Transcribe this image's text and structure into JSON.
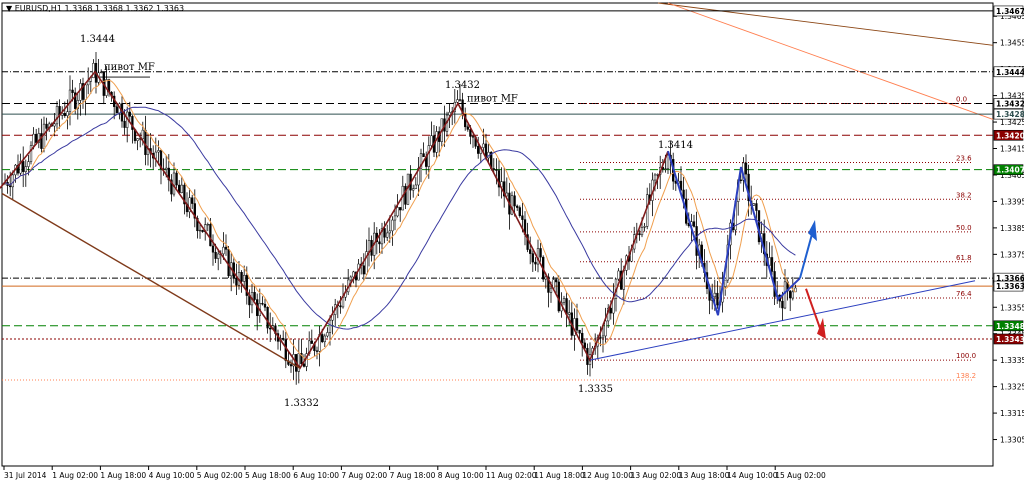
{
  "chart_data": {
    "type": "candlestick",
    "title": "EURUSD,H1  1.3368 1.3368 1.3362 1.3363",
    "ylim": [
      1.3295,
      1.347
    ],
    "x_ticks": [
      "31 Jul 2014",
      "1 Aug 02:00",
      "1 Aug 18:00",
      "4 Aug 10:00",
      "5 Aug 02:00",
      "5 Aug 18:00",
      "6 Aug 10:00",
      "7 Aug 02:00",
      "7 Aug 18:00",
      "8 Aug 10:00",
      "11 Aug 02:00",
      "11 Aug 18:00",
      "12 Aug 10:00",
      "13 Aug 02:00",
      "13 Aug 18:00",
      "14 Aug 10:00",
      "15 Aug 02:00"
    ],
    "y_ticks": [
      1.3305,
      1.3315,
      1.3325,
      1.3335,
      1.3345,
      1.3355,
      1.3365,
      1.3375,
      1.3385,
      1.3395,
      1.3405,
      1.3415,
      1.3425,
      1.3435,
      1.3445,
      1.3455,
      1.3465
    ],
    "price_boxes": [
      {
        "value": "1.3467",
        "price": 1.3467,
        "bg": "#ffffff",
        "fg": "#000000"
      },
      {
        "value": "1.3444",
        "price": 1.3444,
        "bg": "#ffffff",
        "fg": "#000000"
      },
      {
        "value": "1.3432",
        "price": 1.3432,
        "bg": "#ffffff",
        "fg": "#000000"
      },
      {
        "value": "1.3428",
        "price": 1.3428,
        "bg": "#ffffff",
        "fg": "#2f4f4f"
      },
      {
        "value": "1.3420",
        "price": 1.342,
        "bg": "#8b0000",
        "fg": "#ffffff"
      },
      {
        "value": "1.3407",
        "price": 1.3407,
        "bg": "#008000",
        "fg": "#ffffff"
      },
      {
        "value": "1.3366",
        "price": 1.3366,
        "bg": "#ffffff",
        "fg": "#000000"
      },
      {
        "value": "1.3363",
        "price": 1.3363,
        "bg": "#ffffff",
        "fg": "#000000"
      },
      {
        "value": "1.3348",
        "price": 1.3348,
        "bg": "#008000",
        "fg": "#ffffff"
      },
      {
        "value": "1.3343",
        "price": 1.3343,
        "bg": "#8b0000",
        "fg": "#ffffff"
      }
    ],
    "fib_levels": [
      {
        "label": "0.0",
        "price": 1.3432
      },
      {
        "label": "23.6",
        "price": 1.34097
      },
      {
        "label": "38.2",
        "price": 1.33958
      },
      {
        "label": "50.0",
        "price": 1.33835
      },
      {
        "label": "61.8",
        "price": 1.33722
      },
      {
        "label": "76.4",
        "price": 1.33585
      },
      {
        "label": "100.0",
        "price": 1.3335
      },
      {
        "label": "138.2",
        "price": 1.33275
      }
    ],
    "annotations": [
      {
        "text": "1.3444"
      },
      {
        "text": "1.3432"
      },
      {
        "text": "1.3414"
      },
      {
        "text": "1.3332"
      },
      {
        "text": "1.3335"
      },
      {
        "text": "пивот MF"
      },
      {
        "text": "пивот MF"
      }
    ],
    "zigzag": [
      {
        "t": 0,
        "p": 1.34
      },
      {
        "t": 95,
        "p": 1.3444
      },
      {
        "t": 300,
        "p": 1.3332
      },
      {
        "t": 458,
        "p": 1.3432
      },
      {
        "t": 590,
        "p": 1.3335
      },
      {
        "t": 668,
        "p": 1.3414
      }
    ],
    "blue_pattern": [
      {
        "t": 668,
        "p": 1.3414
      },
      {
        "t": 718,
        "p": 1.3352
      },
      {
        "t": 741,
        "p": 1.3408
      },
      {
        "t": 778,
        "p": 1.3358
      },
      {
        "t": 800,
        "p": 1.3366
      }
    ],
    "colors": {
      "resistance": "#8b0000",
      "support": "#008000",
      "zigzag": "#7f1a1a",
      "blue": "#2b3fbf",
      "ma_fast": "#f0a050",
      "ma_slow": "#3a3aa0"
    }
  }
}
